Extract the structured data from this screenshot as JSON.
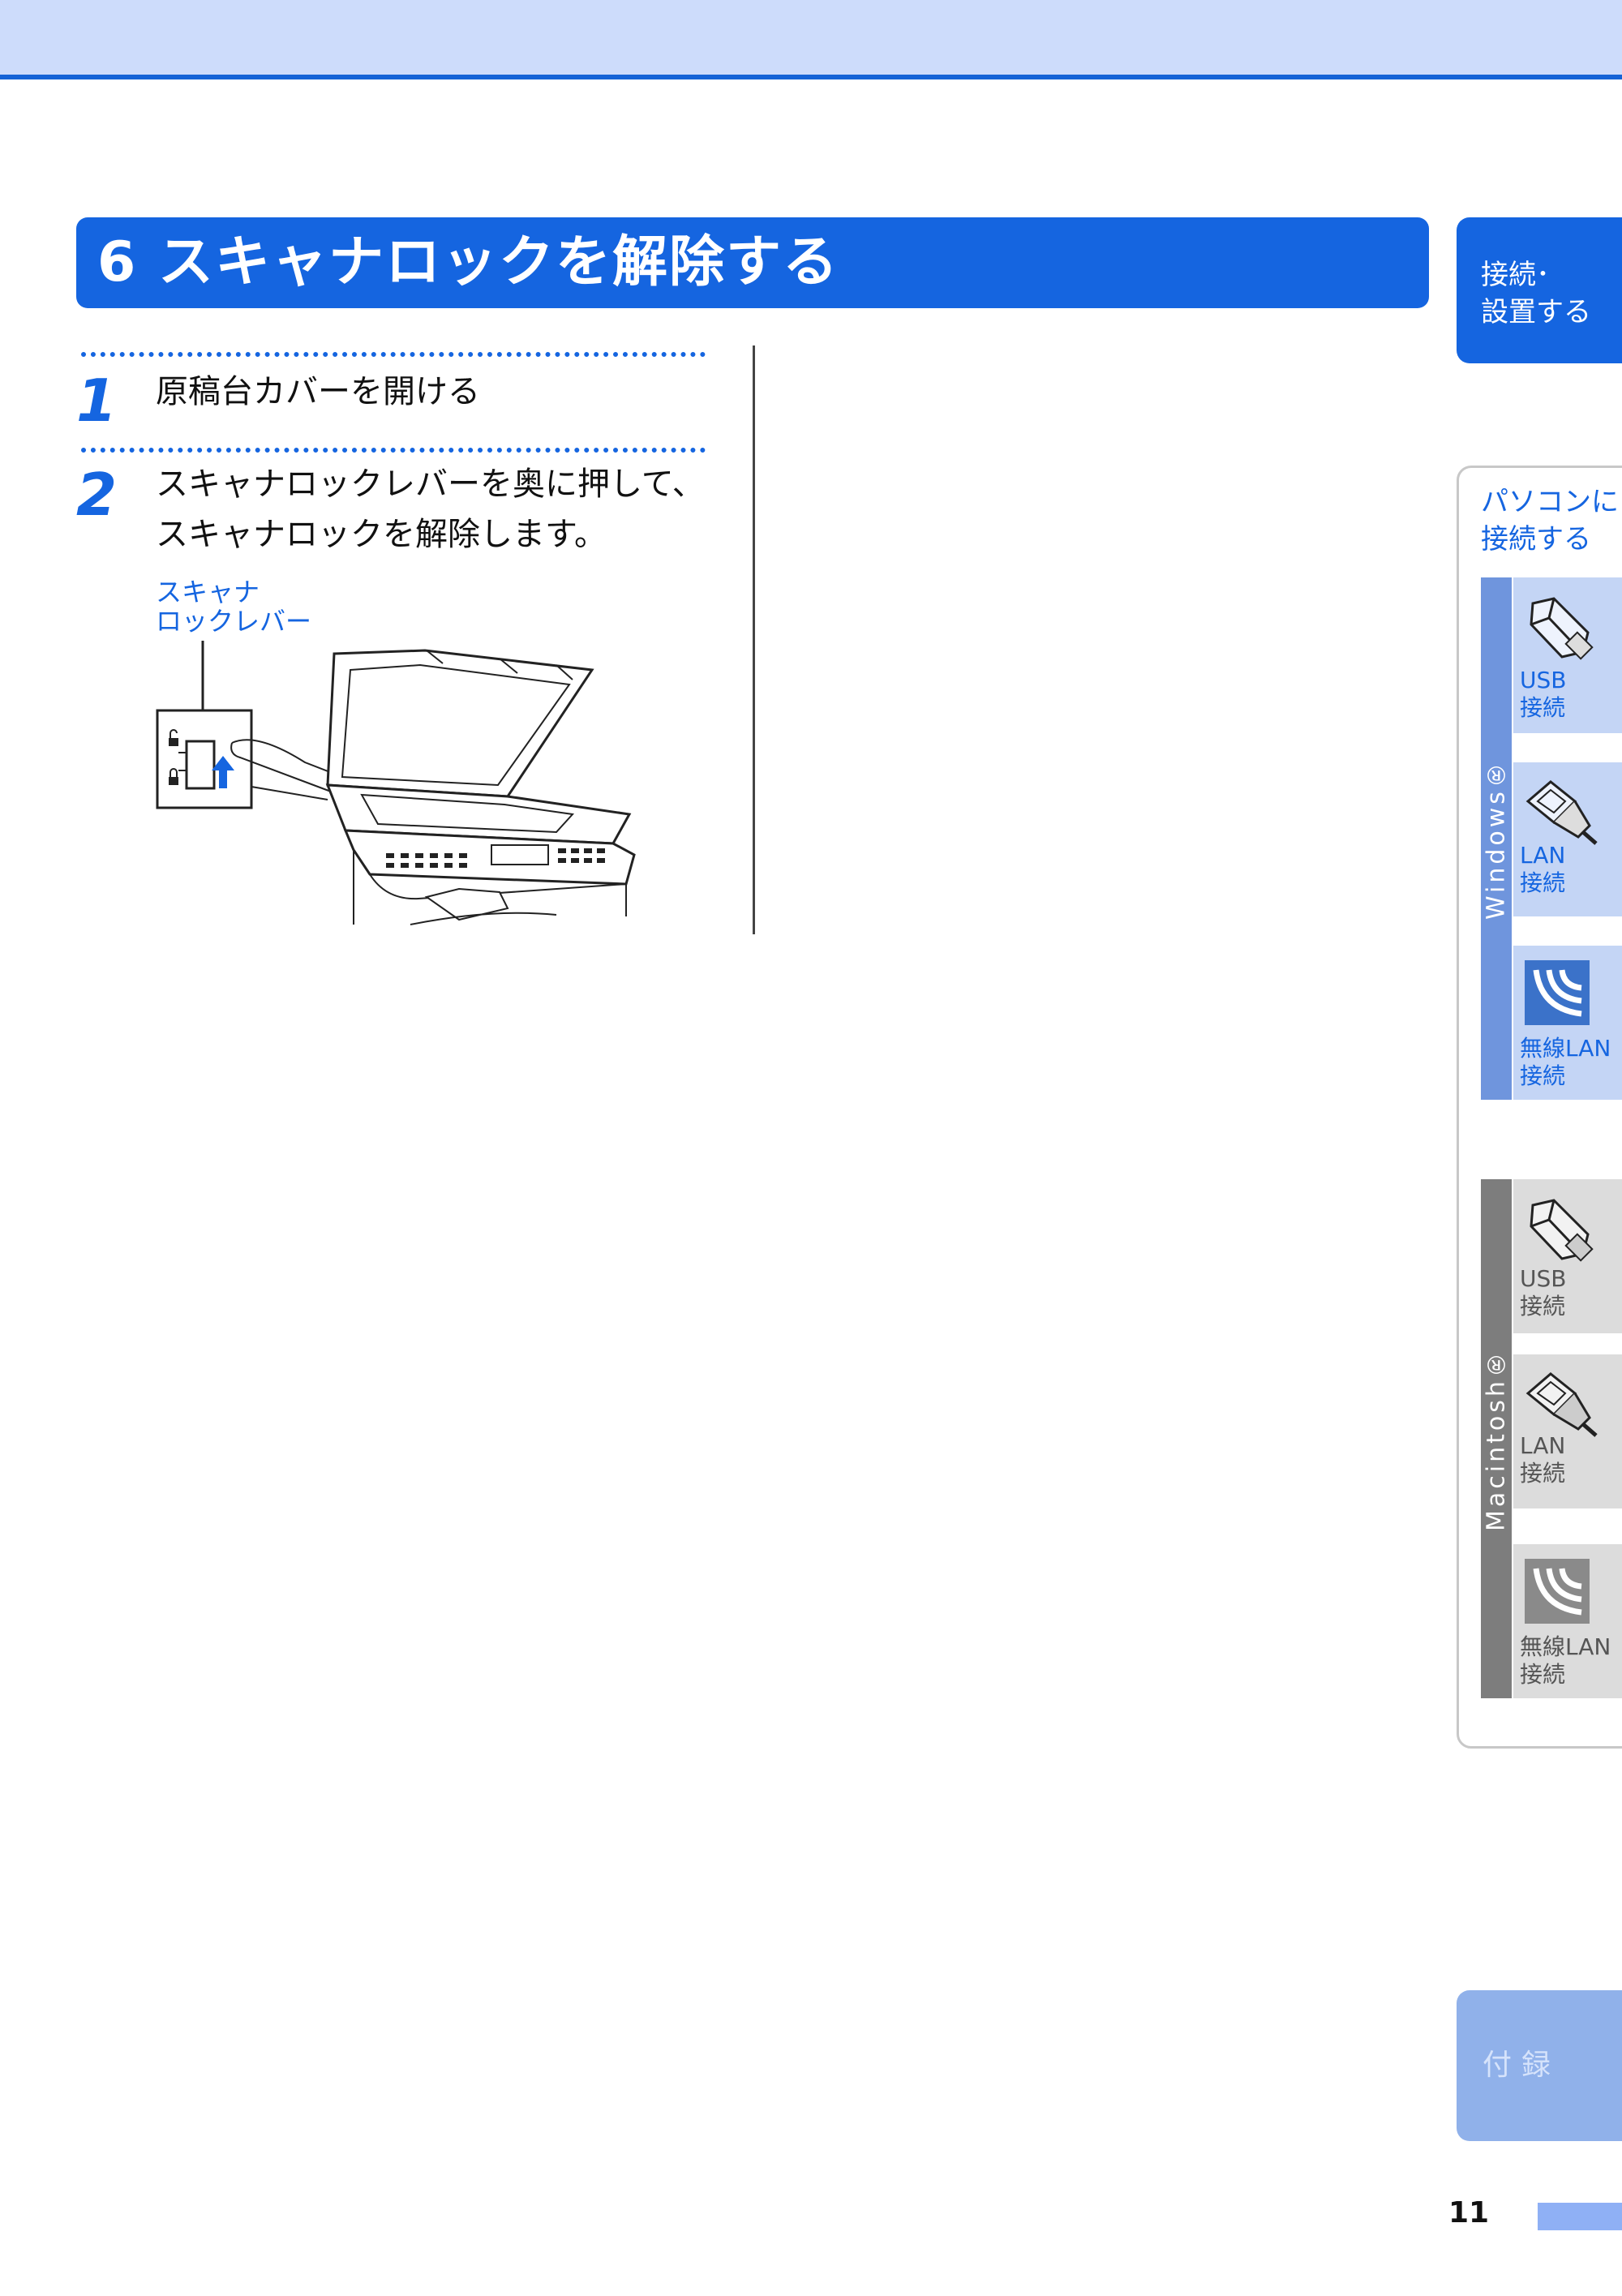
{
  "section": {
    "number": "6",
    "title": "スキャナロックを解除する",
    "full_title": "6 スキャナロックを解除する"
  },
  "steps": [
    {
      "number": "1",
      "text": "原稿台カバーを開ける"
    },
    {
      "number": "2",
      "text_line1": "スキャナロックレバーを奥に押して、",
      "text_line2": "スキャナロックを解除します。"
    }
  ],
  "illustration": {
    "callout_line1": "スキャナ",
    "callout_line2": "ロックレバー"
  },
  "sidebar": {
    "setup_tab": {
      "line1": "接続･",
      "line2": "設置する"
    },
    "pc_heading": {
      "line1": "パソコンに",
      "line2": "接続する"
    },
    "windows": {
      "label": "Windows®",
      "tiles": [
        {
          "line1": "USB",
          "line2": "接続",
          "icon": "usb-cable-icon"
        },
        {
          "line1": "LAN",
          "line2": "接続",
          "icon": "lan-cable-icon"
        },
        {
          "line1": "無線LAN",
          "line2": "接続",
          "icon": "wireless-icon"
        }
      ]
    },
    "macintosh": {
      "label": "Macintosh®",
      "tiles": [
        {
          "line1": "USB",
          "line2": "接続",
          "icon": "usb-cable-icon"
        },
        {
          "line1": "LAN",
          "line2": "接続",
          "icon": "lan-cable-icon"
        },
        {
          "line1": "無線LAN",
          "line2": "接続",
          "icon": "wireless-icon"
        }
      ]
    },
    "appendix_tab": "付録"
  },
  "page_number": "11",
  "colors": {
    "accent": "#1565e0",
    "header_band": "#cddcfb",
    "windows_bar": "#6f95dd",
    "mac_bar": "#7d7d7d"
  }
}
